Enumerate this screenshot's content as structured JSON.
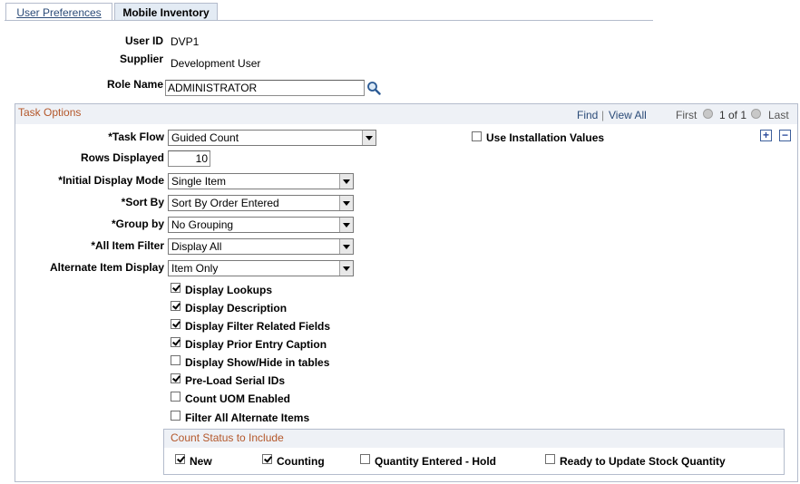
{
  "tabs": [
    {
      "label": "User Preferences"
    },
    {
      "label": "Mobile Inventory"
    }
  ],
  "header": {
    "user_id_label": "User ID",
    "user_id_value": "DVP1",
    "supplier_label": "Supplier",
    "supplier_value": "Development User",
    "role_name_label": "Role Name",
    "role_name_value": "ADMINISTRATOR"
  },
  "task_options": {
    "title": "Task Options",
    "find": "Find",
    "separator": "|",
    "view_all": "View All",
    "first": "First",
    "page_info": "1 of 1",
    "last": "Last",
    "task_flow_label": "*Task Flow",
    "task_flow_value": "Guided Count",
    "use_installation_values": "Use Installation Values",
    "rows_displayed_label": "Rows Displayed",
    "rows_displayed_value": "10",
    "initial_display_mode_label": "*Initial Display Mode",
    "initial_display_mode_value": "Single Item",
    "sort_by_label": "*Sort By",
    "sort_by_value": "Sort By Order Entered",
    "group_by_label": "*Group by",
    "group_by_value": "No Grouping",
    "all_item_filter_label": "*All Item Filter",
    "all_item_filter_value": "Display All",
    "alternate_item_display_label": "Alternate Item Display",
    "alternate_item_display_value": "Item Only",
    "checkboxes": [
      {
        "label": "Display Lookups",
        "checked": true
      },
      {
        "label": "Display Description",
        "checked": true
      },
      {
        "label": "Display Filter Related Fields",
        "checked": true
      },
      {
        "label": "Display Prior Entry Caption",
        "checked": true
      },
      {
        "label": "Display Show/Hide in tables",
        "checked": false
      },
      {
        "label": "Pre-Load Serial IDs",
        "checked": true
      },
      {
        "label": "Count UOM Enabled",
        "checked": false
      },
      {
        "label": "Filter All Alternate Items",
        "checked": false
      }
    ]
  },
  "count_status": {
    "title": "Count Status to Include",
    "items": [
      {
        "label": "New",
        "checked": true
      },
      {
        "label": "Counting",
        "checked": true
      },
      {
        "label": "Quantity Entered - Hold",
        "checked": false
      },
      {
        "label": "Ready to Update Stock Quantity",
        "checked": false
      }
    ]
  },
  "colors": {
    "tab_active_bg": "#e3ebf4",
    "link": "#2b4b78",
    "section_title": "#b4572a",
    "border": "#b4bccc"
  }
}
